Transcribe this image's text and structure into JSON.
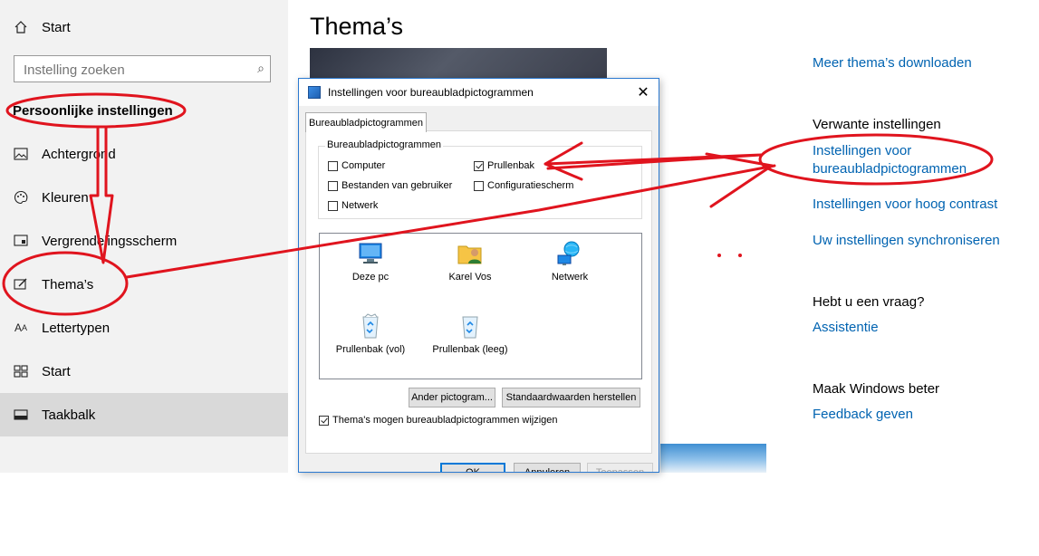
{
  "sidebar": {
    "home": "Start",
    "search_placeholder": "Instelling zoeken",
    "section_title": "Persoonlijke instellingen",
    "items": [
      {
        "label": "Achtergrond",
        "icon": "image-icon"
      },
      {
        "label": "Kleuren",
        "icon": "palette-icon"
      },
      {
        "label": "Vergrendelingsscherm",
        "icon": "lockscreen-icon"
      },
      {
        "label": "Thema’s",
        "icon": "themes-icon"
      },
      {
        "label": "Lettertypen",
        "icon": "fonts-icon"
      },
      {
        "label": "Start",
        "icon": "start-icon"
      },
      {
        "label": "Taakbalk",
        "icon": "taskbar-icon",
        "active": true
      }
    ]
  },
  "main": {
    "title": "Thema’s",
    "links": {
      "more_themes": "Meer thema’s downloaden",
      "related_heading": "Verwante instellingen",
      "desktop_icons_line1": "Instellingen voor",
      "desktop_icons_line2": "bureaubladpictogrammen",
      "high_contrast": "Instellingen voor hoog contrast",
      "sync": "Uw instellingen synchroniseren",
      "question_heading": "Hebt u een vraag?",
      "assist": "Assistentie",
      "improve_heading": "Maak Windows beter",
      "feedback": "Feedback geven"
    }
  },
  "dialog": {
    "title": "Instellingen voor bureaubladpictogrammen",
    "tab": "Bureaubladpictogrammen",
    "group_label": "Bureaubladpictogrammen",
    "checkboxes": [
      {
        "label": "Computer",
        "checked": false
      },
      {
        "label": "Prullenbak",
        "checked": true
      },
      {
        "label": "Bestanden van gebruiker",
        "checked": false
      },
      {
        "label": "Configuratiescherm",
        "checked": false
      },
      {
        "label": "Netwerk",
        "checked": false
      }
    ],
    "icons": [
      {
        "label": "Deze pc",
        "icon": "computer-icon"
      },
      {
        "label": "Karel Vos",
        "icon": "user-folder-icon"
      },
      {
        "label": "Netwerk",
        "icon": "network-icon"
      },
      {
        "label": "Prullenbak (vol)",
        "icon": "recycle-bin-full-icon"
      },
      {
        "label": "Prullenbak (leeg)",
        "icon": "recycle-bin-empty-icon"
      }
    ],
    "change_icon_button": "Ander pictogram...",
    "restore_default_button": "Standaardwaarden herstellen",
    "allow_themes_checkbox": "Thema's mogen bureaubladpictogrammen wijzigen",
    "ok_button": "OK",
    "cancel_button": "Annuleren",
    "apply_button": "Toepassen"
  },
  "colors": {
    "accent": "#0063b1",
    "annotation": "#e0141e",
    "sidebar_bg": "#f2f2f2"
  }
}
